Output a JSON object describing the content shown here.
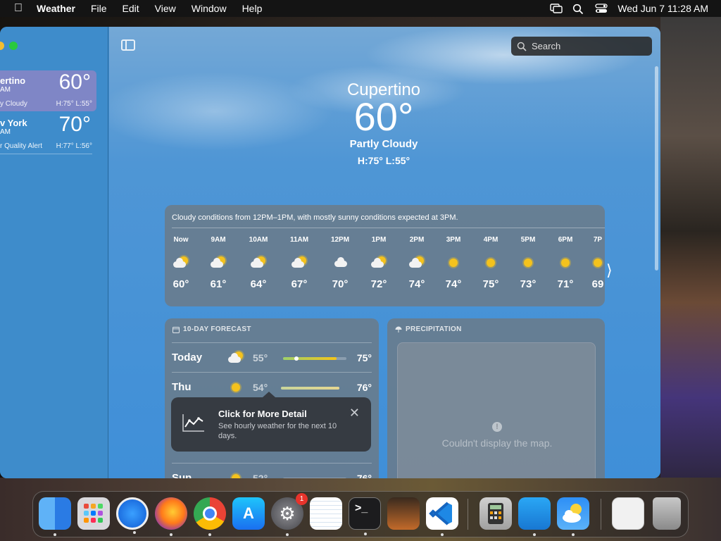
{
  "menubar": {
    "app_name": "Weather",
    "menus": [
      "File",
      "Edit",
      "View",
      "Window",
      "Help"
    ],
    "datetime": "Wed Jun 7  11:28 AM"
  },
  "sidebar": {
    "locations": [
      {
        "name": "ertino",
        "time": "AM",
        "temp": "60°",
        "condition": "y Cloudy",
        "hl": "H:75°  L:55°"
      },
      {
        "name": "v York",
        "time": "AM",
        "temp": "70°",
        "condition": "r Quality Alert",
        "hl": "H:77°  L:56°"
      }
    ]
  },
  "search": {
    "placeholder": "Search"
  },
  "hero": {
    "city": "Cupertino",
    "temp": "60°",
    "condition": "Partly Cloudy",
    "hl": "H:75°  L:55°"
  },
  "hourly": {
    "summary": "Cloudy conditions from 12PM–1PM, with mostly sunny conditions expected at 3PM.",
    "hours": [
      {
        "label": "Now",
        "icon": "partly-cloudy",
        "temp": "60°"
      },
      {
        "label": "9AM",
        "icon": "partly-cloudy",
        "temp": "61°"
      },
      {
        "label": "10AM",
        "icon": "partly-cloudy",
        "temp": "64°"
      },
      {
        "label": "11AM",
        "icon": "partly-cloudy",
        "temp": "67°"
      },
      {
        "label": "12PM",
        "icon": "cloud",
        "temp": "70°"
      },
      {
        "label": "1PM",
        "icon": "partly-cloudy",
        "temp": "72°"
      },
      {
        "label": "2PM",
        "icon": "partly-cloudy",
        "temp": "74°"
      },
      {
        "label": "3PM",
        "icon": "sun",
        "temp": "74°"
      },
      {
        "label": "4PM",
        "icon": "sun",
        "temp": "75°"
      },
      {
        "label": "5PM",
        "icon": "sun",
        "temp": "73°"
      },
      {
        "label": "6PM",
        "icon": "sun",
        "temp": "71°"
      },
      {
        "label": "7P",
        "icon": "sun",
        "temp": "69"
      }
    ]
  },
  "forecast": {
    "title": "10-DAY FORECAST",
    "days": [
      {
        "day": "Today",
        "icon": "partly-cloudy",
        "low": "55°",
        "high": "75°"
      },
      {
        "day": "Thu",
        "icon": "sun",
        "low": "54°",
        "high": "76°"
      },
      {
        "day": "Sun",
        "icon": "sun",
        "low": "52°",
        "high": "76°"
      }
    ]
  },
  "tooltip": {
    "title": "Click for More Detail",
    "body": "See hourly weather for the next 10 days."
  },
  "precipitation": {
    "title": "PRECIPITATION",
    "message": "Couldn't display the map."
  },
  "dock": {
    "apps": [
      "finder",
      "launchpad",
      "safari",
      "firefox",
      "chrome",
      "app-store",
      "system-settings",
      "textedit",
      "terminal",
      "garageband",
      "vscode",
      "calculator",
      "keynote",
      "weather",
      "preview",
      "trash"
    ],
    "badge": "1"
  }
}
